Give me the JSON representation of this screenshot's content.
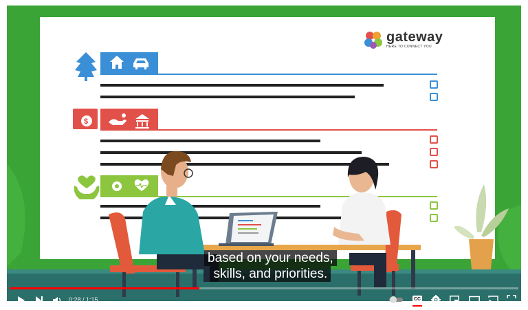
{
  "video": {
    "brand_name": "gateway",
    "brand_tagline": "HERE TO CONNECT YOU",
    "subtitles": [
      "based on your needs,",
      "skills, and priorities."
    ]
  },
  "player": {
    "time_display": "0:28 / 1:15",
    "progress": 0.373,
    "cc_label": "CC",
    "controls": [
      "play-icon",
      "next-icon",
      "volume-icon",
      "autoplay-toggle-icon",
      "cc-icon",
      "settings-gear-icon",
      "miniplayer-icon",
      "theater-mode-icon",
      "cast-icon",
      "fullscreen-icon"
    ]
  },
  "colors": {
    "blue": "#3b8fd6",
    "red": "#e2504a",
    "green": "#8cc63f",
    "background": "#3aa437",
    "progress": "#ff0000"
  }
}
